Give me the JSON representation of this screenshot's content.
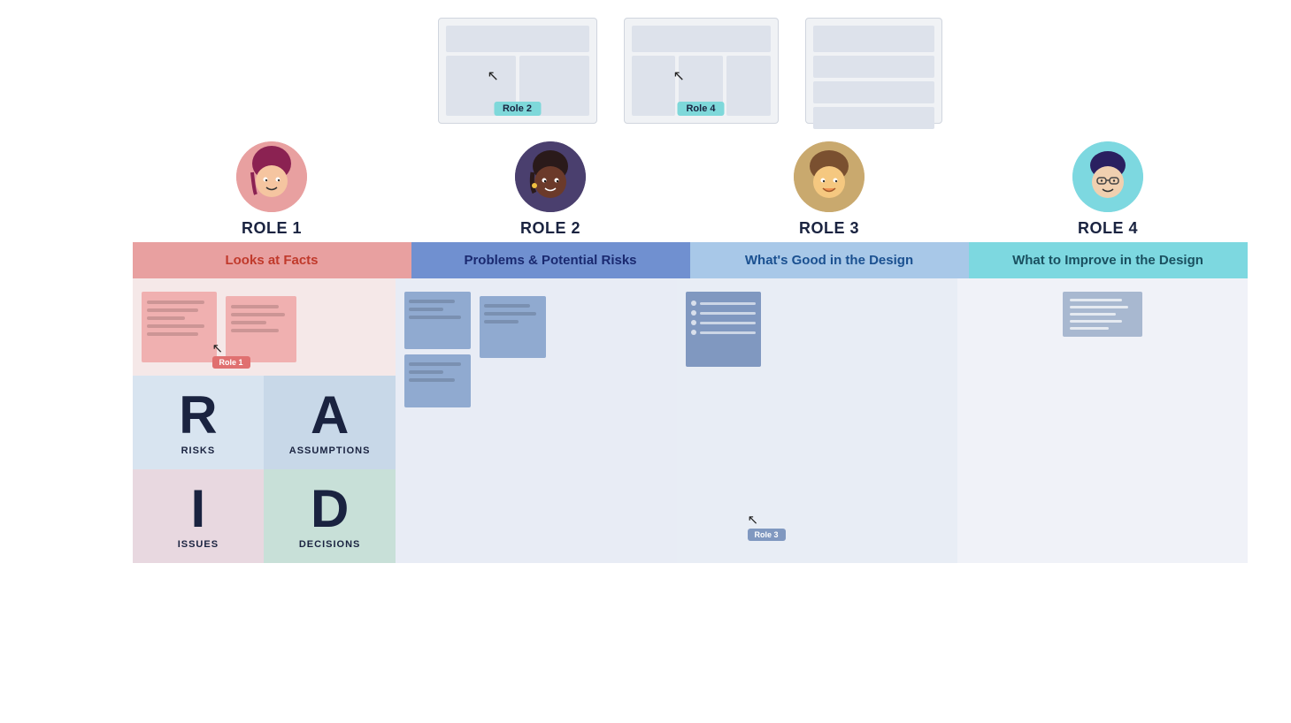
{
  "screens": [
    {
      "id": "screen1",
      "label": "Role 2",
      "type": "two-col"
    },
    {
      "id": "screen2",
      "label": "Role 4",
      "type": "three-col"
    },
    {
      "id": "screen3",
      "label": null,
      "type": "right-stack"
    }
  ],
  "roles": [
    {
      "id": "role1",
      "title": "ROLE 1",
      "emoji": "👩",
      "avatarBg": "#e8a0a0"
    },
    {
      "id": "role2",
      "title": "ROLE 2",
      "emoji": "👨🏾",
      "avatarBg": "#4a3f6e"
    },
    {
      "id": "role3",
      "title": "ROLE 3",
      "emoji": "👦",
      "avatarBg": "#c9a96e"
    },
    {
      "id": "role4",
      "title": "ROLE 4",
      "emoji": "🧓",
      "avatarBg": "#7dd8e0"
    }
  ],
  "colorBars": [
    {
      "id": "bar1",
      "label": "Looks at Facts",
      "bgColor": "#e8a0a0",
      "textColor": "#c0392b"
    },
    {
      "id": "bar2",
      "label": "Problems & Potential Risks",
      "bgColor": "#7090d0",
      "textColor": "#1a2970"
    },
    {
      "id": "bar3",
      "label": "What's Good in the Design",
      "bgColor": "#a8c8e8",
      "textColor": "#1a5090"
    },
    {
      "id": "bar4",
      "label": "What to Improve in the Design",
      "bgColor": "#7dd8e0",
      "textColor": "#1a5060"
    }
  ],
  "raid": [
    {
      "id": "R",
      "letter": "R",
      "word": "RISKS",
      "bg": "#d8e4f0"
    },
    {
      "id": "A",
      "letter": "A",
      "word": "ASSUMPTIONS",
      "bg": "#c8d8e8"
    },
    {
      "id": "I",
      "letter": "I",
      "word": "ISSUES",
      "bg": "#e8d8e0"
    },
    {
      "id": "D",
      "letter": "D",
      "word": "DECISIONS",
      "bg": "#c8e0d8"
    }
  ],
  "labels": {
    "role1_note": "Role 1",
    "role3_note": "Role 3"
  }
}
